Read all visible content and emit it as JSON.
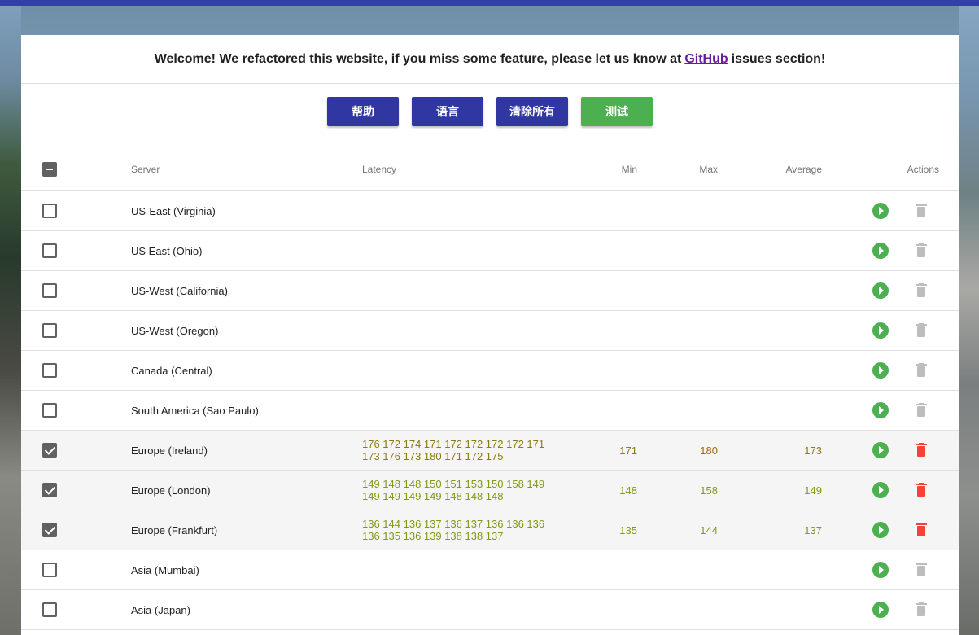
{
  "welcome": {
    "before": "Welcome! We refactored this website, if you miss some feature, please let us know at",
    "link": "GitHub",
    "after": "issues section!"
  },
  "buttons": {
    "help": "帮助",
    "language": "语言",
    "clear_all": "清除所有",
    "test": "测试"
  },
  "colors": {
    "primary": "#3037a0",
    "success": "#4caf50",
    "danger": "#f44336",
    "topbar": "#3340a6"
  },
  "table": {
    "headers": {
      "server": "Server",
      "latency": "Latency",
      "min": "Min",
      "max": "Max",
      "average": "Average",
      "actions": "Actions"
    },
    "rows": [
      {
        "server": "US-East (Virginia)",
        "latency1": "",
        "latency2": "",
        "min": "",
        "max": "",
        "avg": ""
      },
      {
        "server": "US East (Ohio)",
        "latency1": "",
        "latency2": "",
        "min": "",
        "max": "",
        "avg": ""
      },
      {
        "server": "US-West (California)",
        "latency1": "",
        "latency2": "",
        "min": "",
        "max": "",
        "avg": ""
      },
      {
        "server": "US-West (Oregon)",
        "latency1": "",
        "latency2": "",
        "min": "",
        "max": "",
        "avg": ""
      },
      {
        "server": "Canada (Central)",
        "latency1": "",
        "latency2": "",
        "min": "",
        "max": "",
        "avg": ""
      },
      {
        "server": "South America (Sao Paulo)",
        "latency1": "",
        "latency2": "",
        "min": "",
        "max": "",
        "avg": ""
      },
      {
        "server": "Europe (Ireland)",
        "latency1": "176 172 174 171 172 172 172 172 171",
        "latency2": "173 176 173 180 171 172 175",
        "min": "171",
        "max": "180",
        "avg": "173"
      },
      {
        "server": "Europe (London)",
        "latency1": "149 148 148 150 151 153 150 158 149",
        "latency2": "149 149 149 149 148 148 148",
        "min": "148",
        "max": "158",
        "avg": "149"
      },
      {
        "server": "Europe (Frankfurt)",
        "latency1": "136 144 136 137 136 137 136 136 136",
        "latency2": "136 135 136 139 138 138 137",
        "min": "135",
        "max": "144",
        "avg": "137"
      },
      {
        "server": "Asia (Mumbai)",
        "latency1": "",
        "latency2": "",
        "min": "",
        "max": "",
        "avg": ""
      },
      {
        "server": "Asia (Japan)",
        "latency1": "",
        "latency2": "",
        "min": "",
        "max": "",
        "avg": ""
      }
    ]
  }
}
